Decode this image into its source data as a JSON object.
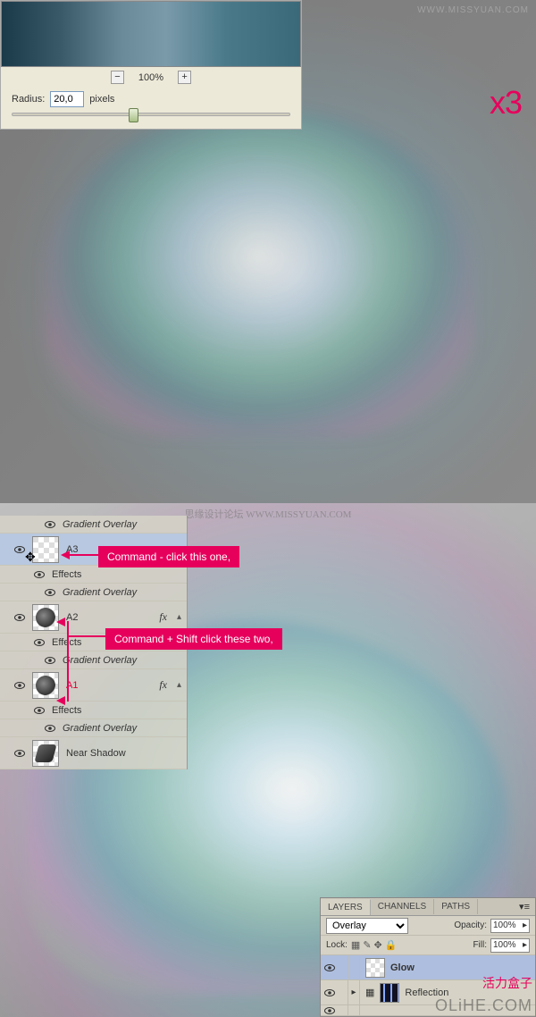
{
  "topDialog": {
    "zoomPercent": "100%",
    "radiusLabel": "Radius:",
    "radiusValue": "20,0",
    "radiusUnit": "pixels",
    "repeatLabel": "x3"
  },
  "watermarks": {
    "top1": "WWW.MISSYUAN.COM",
    "mid": "思缘设计论坛    WWW.MISSYUAN.COM",
    "red": "活力盒子",
    "gray": "OLiHE.COM"
  },
  "leftLayers": {
    "gradOverlay": "Gradient Overlay",
    "effects": "Effects",
    "a3": "A3",
    "a2": "A2",
    "a1": "A1",
    "nearShadow": "Near Shadow",
    "fx": "fx"
  },
  "callouts": {
    "c1": "Command - click this one,",
    "c2": "Command + Shift click these two,"
  },
  "panel": {
    "tabLayers": "LAYERS",
    "tabChannels": "CHANNELS",
    "tabPaths": "PATHS",
    "blend": "Overlay",
    "opacityLabel": "Opacity:",
    "opacityVal": "100%",
    "lockLabel": "Lock:",
    "fillLabel": "Fill:",
    "fillVal": "100%",
    "layerGlow": "Glow",
    "layerReflection": "Reflection"
  }
}
